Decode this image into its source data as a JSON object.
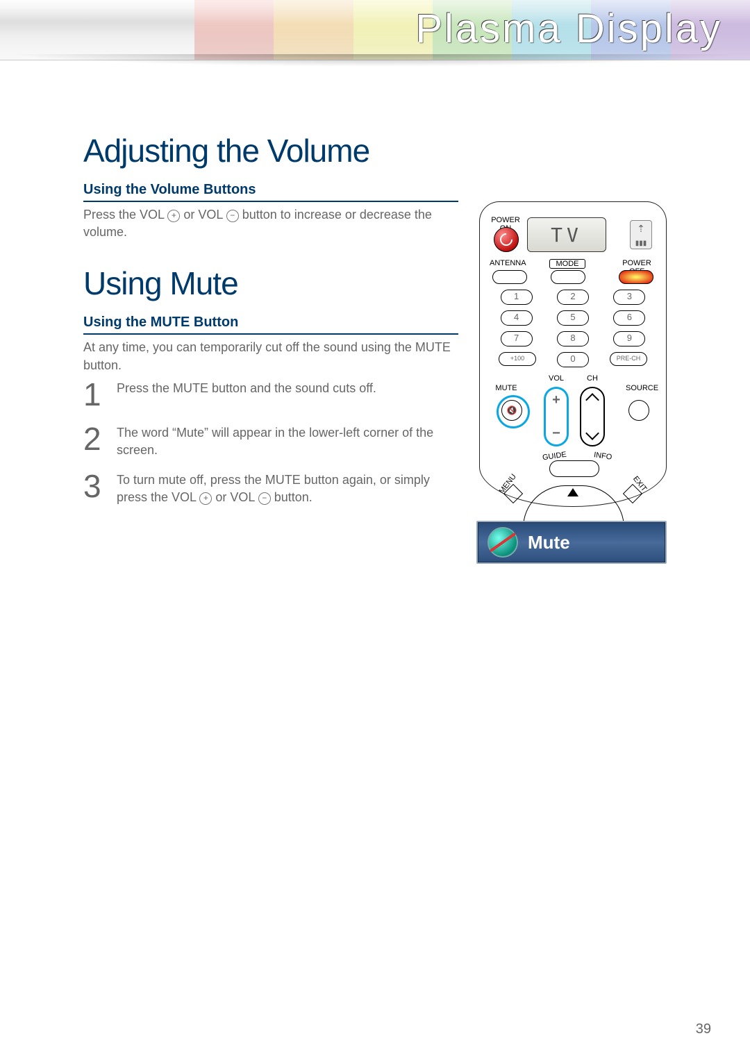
{
  "banner": {
    "product_title": "Plasma Display"
  },
  "section1": {
    "title": "Adjusting the Volume",
    "sub": "Using the Volume Buttons",
    "body_pre": "Press the VOL ",
    "vol_plus": "+",
    "body_mid": " or VOL ",
    "vol_minus": "−",
    "body_post": " button to increase or decrease the volume."
  },
  "section2": {
    "title": "Using Mute",
    "sub": "Using the MUTE Button",
    "body": "At any time, you can temporarily cut off the sound using the MUTE button.",
    "steps": {
      "s1": "Press the MUTE button and the sound cuts off.",
      "s2": "The word “Mute” will appear in the lower-left corner of the screen.",
      "s3_pre": "To turn mute off, press the MUTE button again, or simply press the VOL ",
      "s3_mid": " or VOL ",
      "s3_post": " button."
    }
  },
  "remote": {
    "power_on": "POWER ON",
    "lcd": "TV",
    "antenna": "ANTENNA",
    "mode": "MODE",
    "power_off": "POWER OFF",
    "nums": [
      "1",
      "2",
      "3",
      "4",
      "5",
      "6",
      "7",
      "8",
      "9"
    ],
    "plus100": "+100",
    "zero": "0",
    "prech": "PRE-CH",
    "vol": "VOL",
    "ch": "CH",
    "mute": "MUTE",
    "source": "SOURCE",
    "guide": "GUIDE",
    "info": "INFO",
    "menu": "MENU",
    "exit": "EXIT"
  },
  "osd": {
    "label": "Mute"
  },
  "page_number": "39"
}
